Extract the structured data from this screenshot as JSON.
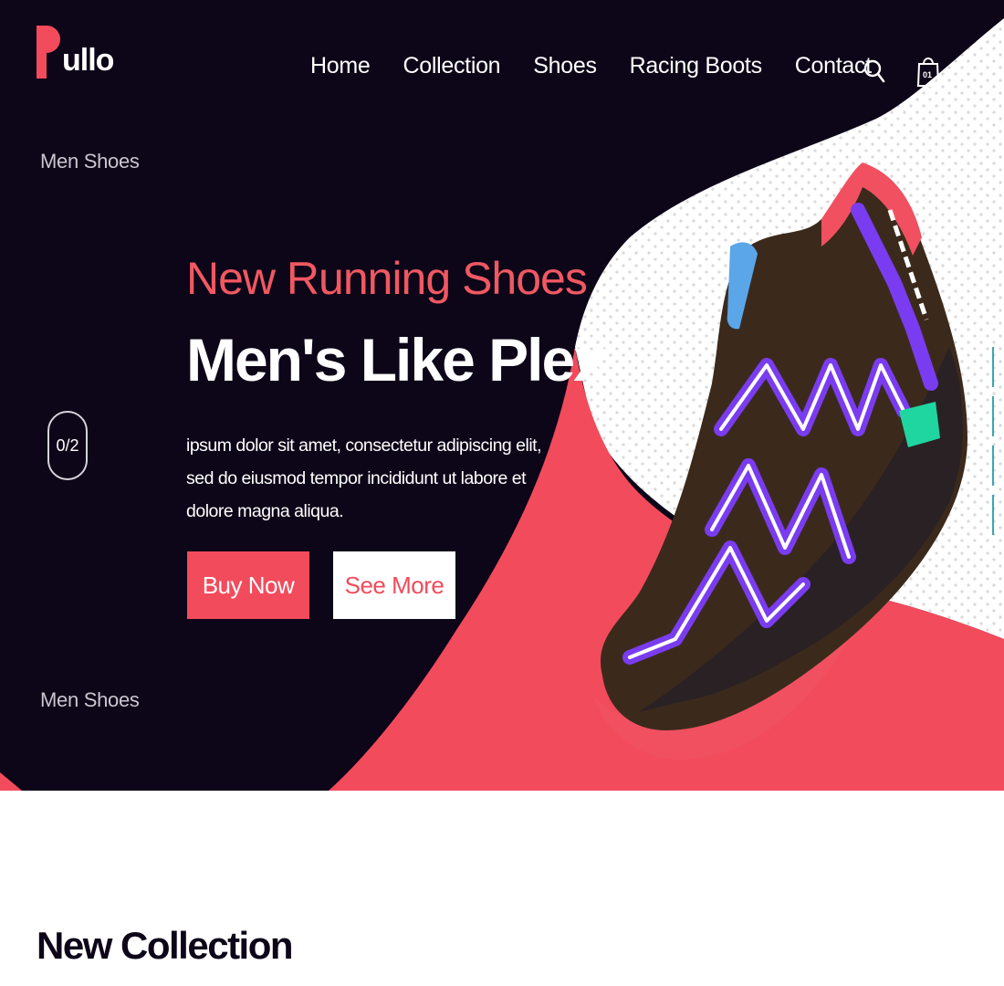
{
  "brand": {
    "logo_letter": "P",
    "logo_rest": "ullo"
  },
  "nav": {
    "items": [
      "Home",
      "Collection",
      "Shoes",
      "Racing Boots",
      "Contact"
    ],
    "cart_count": "01",
    "search_icon": "search-icon",
    "cart_icon": "shopping-bag-icon"
  },
  "hero": {
    "side_label_top": "Men Shoes",
    "side_label_bottom": "Men Shoes",
    "slide_counter": "0/2",
    "subtitle": "New Running Shoes",
    "title": "Men's Like Plex",
    "description": "ipsum dolor sit amet, consectetur adipiscing elit, sed do eiusmod tempor incididunt ut labore et dolore magna aliqua.",
    "buy_label": "Buy Now",
    "more_label": "See More",
    "slider_dots": 4
  },
  "collection": {
    "title": "New Collection"
  },
  "colors": {
    "dark": "#0d0518",
    "accent": "#f24b5c",
    "dots": "#3aa7b5"
  }
}
